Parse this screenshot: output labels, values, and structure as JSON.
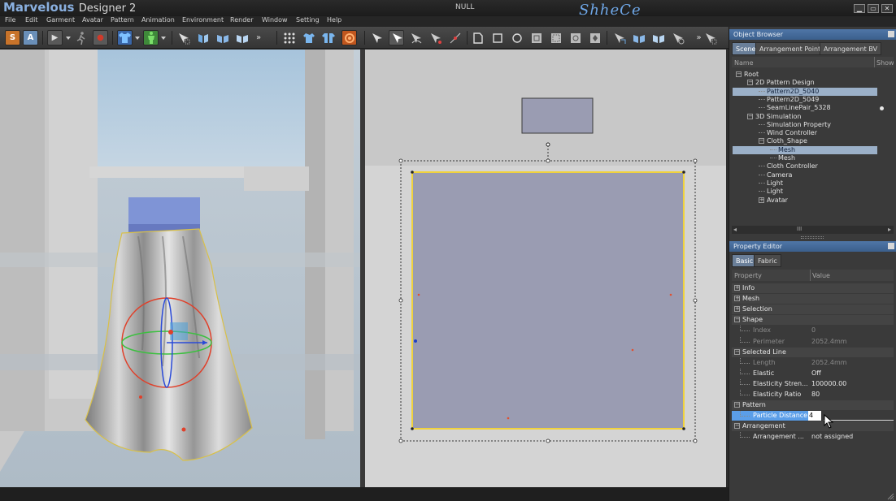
{
  "window": {
    "app_name": "Marvelous",
    "app_subtitle": "Designer 2",
    "document_name": "NULL",
    "watermark": "ShheCe",
    "minimize_glyph": "▁",
    "restore_glyph": "▭",
    "close_glyph": "✕"
  },
  "menu": [
    "File",
    "Edit",
    "Garment",
    "Avatar",
    "Pattern",
    "Animation",
    "Environment",
    "Render",
    "Window",
    "Setting",
    "Help"
  ],
  "toolbar": {
    "sim_toggle": "S",
    "anim_toggle": "A",
    "play_glyph": "▶",
    "record_glyph": "●",
    "more_glyph": "»"
  },
  "object_browser": {
    "title": "Object Browser",
    "tabs": [
      "Scene",
      "Arrangement Point",
      "Arrangement BV"
    ],
    "columns": [
      "Name",
      "Show"
    ],
    "tree": [
      {
        "label": "Root",
        "depth": 0,
        "expander": "−"
      },
      {
        "label": "2D Pattern Design",
        "depth": 1,
        "expander": "−"
      },
      {
        "label": "Pattern2D_5040",
        "depth": 2,
        "expander": "",
        "selected": true
      },
      {
        "label": "Pattern2D_5049",
        "depth": 2,
        "expander": ""
      },
      {
        "label": "SeamLinePair_5328",
        "depth": 2,
        "expander": "",
        "show_dot": true
      },
      {
        "label": "3D Simulation",
        "depth": 1,
        "expander": "−"
      },
      {
        "label": "Simulation Property",
        "depth": 2,
        "expander": ""
      },
      {
        "label": "Wind Controller",
        "depth": 2,
        "expander": ""
      },
      {
        "label": "Cloth_Shape",
        "depth": 2,
        "expander": "−"
      },
      {
        "label": "Mesh",
        "depth": 3,
        "expander": "",
        "selected": true
      },
      {
        "label": "Mesh",
        "depth": 3,
        "expander": ""
      },
      {
        "label": "Cloth Controller",
        "depth": 2,
        "expander": ""
      },
      {
        "label": "Camera",
        "depth": 2,
        "expander": ""
      },
      {
        "label": "Light",
        "depth": 2,
        "expander": ""
      },
      {
        "label": "Light",
        "depth": 2,
        "expander": ""
      },
      {
        "label": "Avatar",
        "depth": 2,
        "expander": "+"
      }
    ],
    "scrollbar_grip": "III"
  },
  "property_editor": {
    "title": "Property Editor",
    "tabs": [
      "Basic",
      "Fabric"
    ],
    "columns": [
      "Property",
      "Value"
    ],
    "rows": [
      {
        "name": "Info",
        "value": "",
        "type": "group",
        "expander": "+"
      },
      {
        "name": "Mesh",
        "value": "",
        "type": "group",
        "expander": "+"
      },
      {
        "name": "Selection",
        "value": "",
        "type": "group",
        "expander": "+"
      },
      {
        "name": "Shape",
        "value": "",
        "type": "group",
        "expander": "−"
      },
      {
        "name": "Index",
        "value": "0",
        "type": "dim"
      },
      {
        "name": "Perimeter",
        "value": "2052.4mm",
        "type": "dim"
      },
      {
        "name": "Selected Line",
        "value": "",
        "type": "group",
        "expander": "−"
      },
      {
        "name": "Length",
        "value": "2052.4mm",
        "type": "dim"
      },
      {
        "name": "Elastic",
        "value": "Off",
        "type": "item"
      },
      {
        "name": "Elasticity Stren...",
        "value": "100000.00",
        "type": "item"
      },
      {
        "name": "Elasticity Ratio",
        "value": "80",
        "type": "item"
      },
      {
        "name": "Pattern",
        "value": "",
        "type": "group",
        "expander": "−"
      },
      {
        "name": "Particle Distance",
        "value": "4",
        "type": "highlight"
      },
      {
        "name": "Arrangement",
        "value": "",
        "type": "group",
        "expander": "−"
      },
      {
        "name": "Arrangement ...",
        "value": "not assigned",
        "type": "item"
      }
    ]
  },
  "colors": {
    "accent_blue": "#4f76a7",
    "selection": "#9bb0c8",
    "pattern_fill": "#9a9cb2",
    "pattern_outline": "#f0d23c",
    "gizmo_red": "#e0402a",
    "gizmo_green": "#3cc040",
    "gizmo_blue": "#2a4ad8"
  }
}
